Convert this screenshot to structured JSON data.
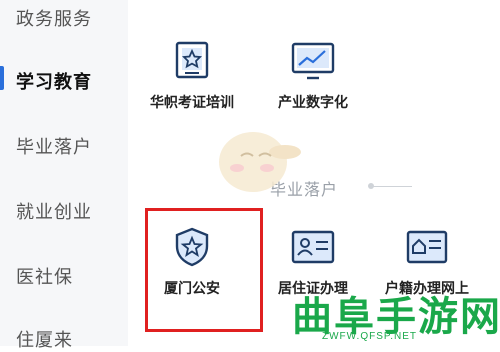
{
  "sidebar": {
    "items": [
      {
        "label": "政务服务"
      },
      {
        "label": "学习教育"
      },
      {
        "label": "毕业落户"
      },
      {
        "label": "就业创业"
      },
      {
        "label": "医社保"
      },
      {
        "label": "住厦来"
      }
    ],
    "active_index": 1,
    "accent_color": "#2a6fdb"
  },
  "tiles": [
    {
      "label": "华帜考证培训",
      "icon": "certificate-star-icon"
    },
    {
      "label": "产业数字化",
      "icon": "monitor-chart-icon"
    },
    {
      "label": "厦门公安",
      "icon": "police-shield-icon"
    },
    {
      "label": "居住证办理",
      "icon": "id-card-icon"
    },
    {
      "label": "户籍办理网上",
      "icon": "household-register-icon"
    }
  ],
  "section": {
    "title": "毕业落户"
  },
  "highlight_color": "#e02020",
  "watermark": {
    "title": "曲阜手游网",
    "url": "ZWFW.QFSP.NET",
    "color": "#1aa84a"
  }
}
